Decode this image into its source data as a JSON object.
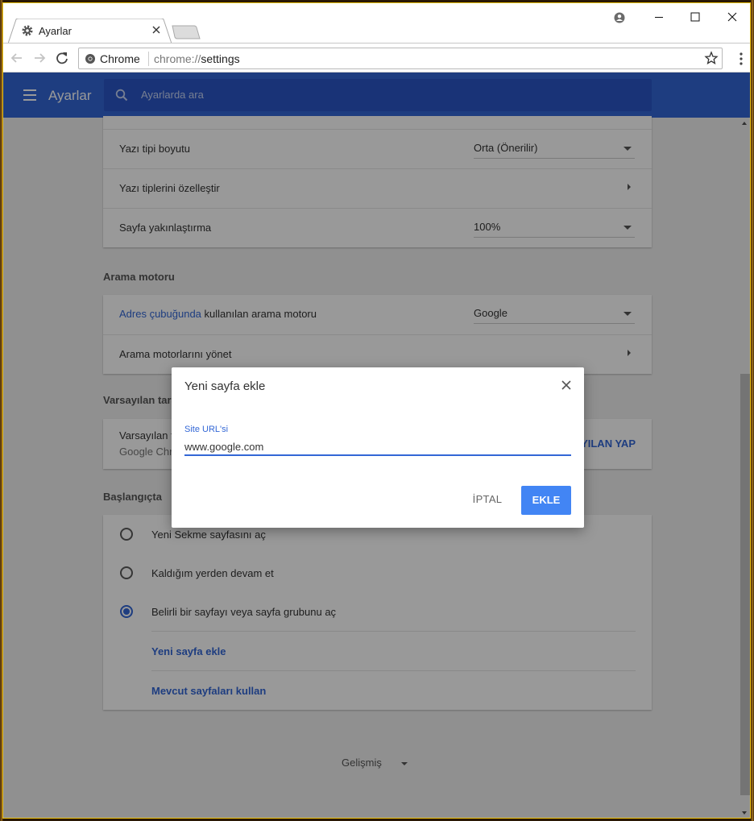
{
  "browser": {
    "tab_title": "Ayarlar",
    "omnibox_label": "Chrome",
    "url_scheme": "chrome://",
    "url_path": "settings"
  },
  "header": {
    "title": "Ayarlar",
    "search_placeholder": "Ayarlarda ara"
  },
  "appearance": {
    "rows": [
      {
        "label": "Yazı tipi boyutu",
        "value": "Orta (Önerilir)"
      },
      {
        "label": "Yazı tiplerini özelleştir"
      },
      {
        "label": "Sayfa yakınlaştırma",
        "value": "100%"
      }
    ]
  },
  "search_engine": {
    "section_title": "Arama motoru",
    "row1_link": "Adres çubuğunda",
    "row1_text": " kullanılan arama motoru",
    "row1_value": "Google",
    "row2_label": "Arama motorlarını yönet"
  },
  "default_browser": {
    "section_title": "Varsayılan tarayıcı",
    "label": "Varsayılan tarayıcı",
    "sublabel": "Google Chrome'u varsayılan tarayıcı yap",
    "button": "VARSAYILAN YAP"
  },
  "on_startup": {
    "section_title": "Başlangıçta",
    "options": [
      {
        "label": "Yeni Sekme sayfasını aç",
        "selected": false
      },
      {
        "label": "Kaldığım yerden devam et",
        "selected": false
      },
      {
        "label": "Belirli bir sayfayı veya sayfa grubunu aç",
        "selected": true
      }
    ],
    "add_page_link": "Yeni sayfa ekle",
    "use_current_link": "Mevcut sayfaları kullan"
  },
  "advanced_label": "Gelişmiş",
  "dialog": {
    "title": "Yeni sayfa ekle",
    "field_label": "Site URL'si",
    "field_value": "www.google.com",
    "cancel_label": "İPTAL",
    "ok_label": "EKLE"
  },
  "colors": {
    "accent": "#3367d6",
    "primary_button": "#4285f4",
    "window_border": "#f1c40f"
  }
}
